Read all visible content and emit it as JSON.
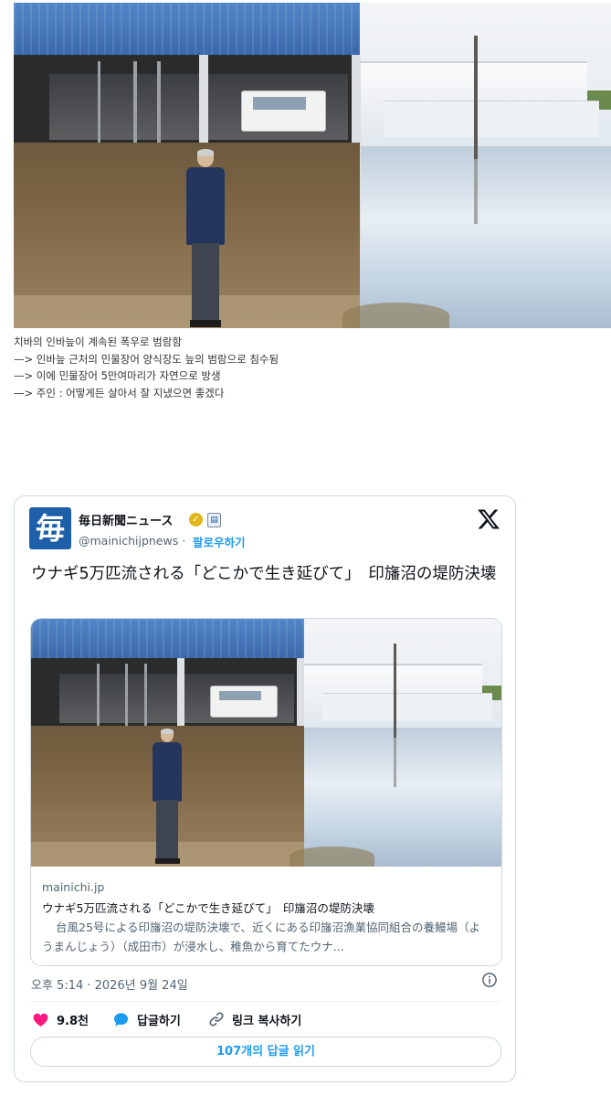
{
  "post": {
    "caption_lines": [
      "치바의 인바늪이 계속된 폭우로 범람함",
      "—> 인바늪 근처의 민물장어 양식장도 늪의 범람으로 침수됨",
      "—> 이에 민물장어 5만여마리가 자연으로 방생",
      "—> 주인 : 어떻게든 살아서 잘 지냈으면 좋겠다"
    ]
  },
  "tweet": {
    "logo_char": "毎",
    "account_name": "毎日新聞ニュース",
    "verified_icon": "verified-badge-gold",
    "affiliate_icon": "affiliate-badge",
    "handle": "@mainichijpnews",
    "separator": "·",
    "follow_label": "팔로우하기",
    "text": "ウナギ5万匹流される「どこかで生き延びて」　印旛沼の堤防決壊",
    "link_card": {
      "domain": "mainichi.jp",
      "title": "ウナギ5万匹流される「どこかで生き延びて」　印旛沼の堤防決壊",
      "description": "台風25号による印旛沼の堤防決壊で、近くにある印旛沼漁業協同組合の養鰻場（ようまんじょう）（成田市）が浸水し、稚魚から育てたウナ..."
    },
    "timestamp": "오후 5:14 · 2026년 9월 24일",
    "actions": {
      "likes": "9.8천",
      "reply_label": "답글하기",
      "copy_link_label": "링크 복사하기"
    },
    "read_replies_label": "107개의 답글 읽기",
    "colors": {
      "accent": "#1d9bf0",
      "like": "#f91880",
      "logo_bg": "#1d5fa8"
    }
  }
}
